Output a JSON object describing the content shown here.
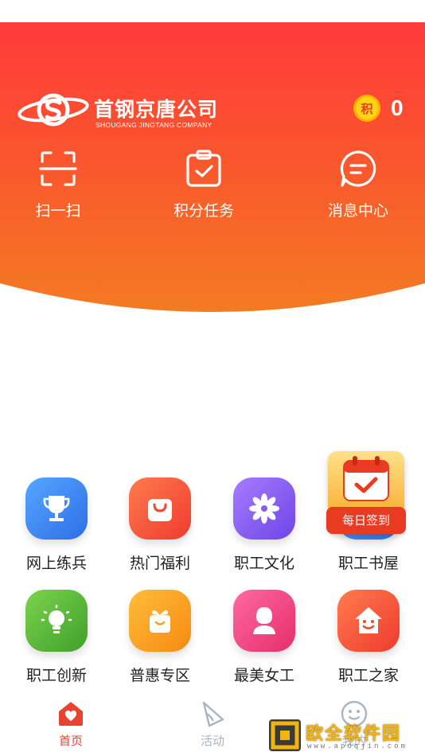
{
  "app": {
    "logo": {
      "name_cn": "首钢京唐公司",
      "name_en": "SHOUGANG JINGTANG COMPANY"
    },
    "points": {
      "coin_label": "积",
      "value": "0"
    }
  },
  "quick_actions": [
    {
      "icon": "scan-icon",
      "label": "扫一扫"
    },
    {
      "icon": "task-clipboard-icon",
      "label": "积分任务"
    },
    {
      "icon": "message-icon",
      "label": "消息中心"
    }
  ],
  "grid": [
    {
      "icon": "trophy-icon",
      "label": "网上练兵",
      "color": "#3d8bf2"
    },
    {
      "icon": "shopping-bag-icon",
      "label": "热门福利",
      "color": "#f5543a"
    },
    {
      "icon": "flower-icon",
      "label": "职工文化",
      "color": "#8b5cf0"
    },
    {
      "icon": "book-icon",
      "label": "职工书屋",
      "color": "#3d8bf2"
    },
    {
      "icon": "lightbulb-icon",
      "label": "职工创新",
      "color": "#56b93a"
    },
    {
      "icon": "gift-box-icon",
      "label": "普惠专区",
      "color": "#f7a21e"
    },
    {
      "icon": "woman-icon",
      "label": "最美女工",
      "color": "#f0457f"
    },
    {
      "icon": "home-icon",
      "label": "职工之家",
      "color": "#f5543a"
    }
  ],
  "floating": {
    "daily_signin_label": "每日签到"
  },
  "tabbar": {
    "items": [
      {
        "icon": "home-heart-icon",
        "label": "首页",
        "active": true
      },
      {
        "icon": "activity-flag-icon",
        "label": "活动",
        "active": false
      },
      {
        "icon": "smiley-icon",
        "label": "我的",
        "active": false
      }
    ],
    "active_color": "#e8432f",
    "inactive_color": "#aab4c0"
  },
  "watermark": {
    "name_cn": "欧全软件园",
    "url": "www.apoqjin.com"
  },
  "colors": {
    "header_top": "#ff3b3b",
    "header_bottom": "#f57a22"
  }
}
